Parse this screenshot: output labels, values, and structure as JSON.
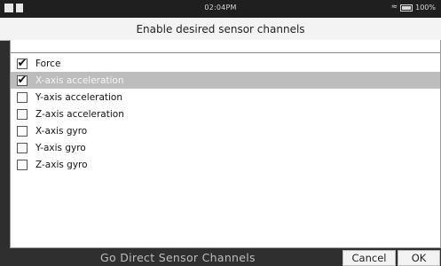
{
  "status_bar": {
    "time": "02:04PM",
    "battery": "100%"
  },
  "header": {
    "title": "Enable desired sensor channels"
  },
  "channels": [
    {
      "label": "Force",
      "checked": true,
      "selected": false
    },
    {
      "label": "X-axis acceleration",
      "checked": true,
      "selected": true
    },
    {
      "label": "Y-axis acceleration",
      "checked": false,
      "selected": false
    },
    {
      "label": "Z-axis acceleration",
      "checked": false,
      "selected": false
    },
    {
      "label": "X-axis gyro",
      "checked": false,
      "selected": false
    },
    {
      "label": "Y-axis gyro",
      "checked": false,
      "selected": false
    },
    {
      "label": "Z-axis gyro",
      "checked": false,
      "selected": false
    }
  ],
  "bottom_bar": {
    "title": "Go Direct Sensor Channels",
    "cancel_label": "Cancel",
    "ok_label": "OK"
  }
}
